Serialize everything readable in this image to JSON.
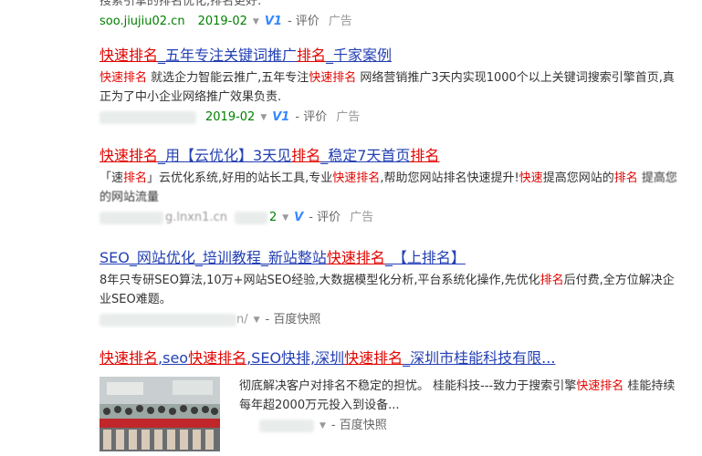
{
  "results": [
    {
      "abstract_tail": "搜索引擎的排名优化,排名更好.",
      "url": "soo.jiujiu02.cn",
      "date": "2019-02",
      "badge": "V1",
      "eval": "评价",
      "ad": "广告"
    },
    {
      "title": [
        "快速排名",
        "_五年专注关键词推广",
        "排名",
        "_千家案例"
      ],
      "abstract": [
        "快速排名",
        " 就选企力智能云推广,五年专注",
        "快速排名",
        " 网络营销推广3天内实现1000个以上关键词搜索引擎首页,真正为了中小企业网络推广效果负责."
      ],
      "date": "2019-02",
      "badge": "V1",
      "eval": "评价",
      "ad": "广告"
    },
    {
      "title": [
        "快速排名",
        "_用【云优化】3天见",
        "排名",
        "_稳定7天首页",
        "排名"
      ],
      "abstract": [
        "「速",
        "排名",
        "」云优化系统,好用的站长工具,专业",
        "快速排名",
        ",帮助您网站排名快速提升!",
        "快速",
        "提高您网站的",
        "排名",
        " 提高您的网站流量"
      ],
      "url_tail": "g.lnxn1.cn",
      "date_tail": "2",
      "badge": "V",
      "eval": "评价",
      "ad": "广告"
    },
    {
      "title": [
        "SEO_网站优化_培训教程_新站整站",
        "快速排名",
        "_【上排名】"
      ],
      "abstract": [
        "8年只专研SEO算法,10万+网站SEO经验,大数据模型化分析,平台系统化操作,先优化",
        "排名",
        "后付费,全方位解决企业SEO难题。"
      ],
      "url_tail": "n/",
      "snapshot": "百度快照"
    },
    {
      "title": [
        "快速排名",
        ",seo",
        "快速排名",
        ",SEO快排,深圳",
        "快速排名",
        "_深圳市桂能科技有限..."
      ],
      "abstract": [
        "彻底解决客户对排名不稳定的担忧。 桂能科技---致力于搜索引擎",
        "快速排名",
        " 桂能持续每年超2000万元投入到设备..."
      ],
      "snapshot": "百度快照"
    }
  ]
}
